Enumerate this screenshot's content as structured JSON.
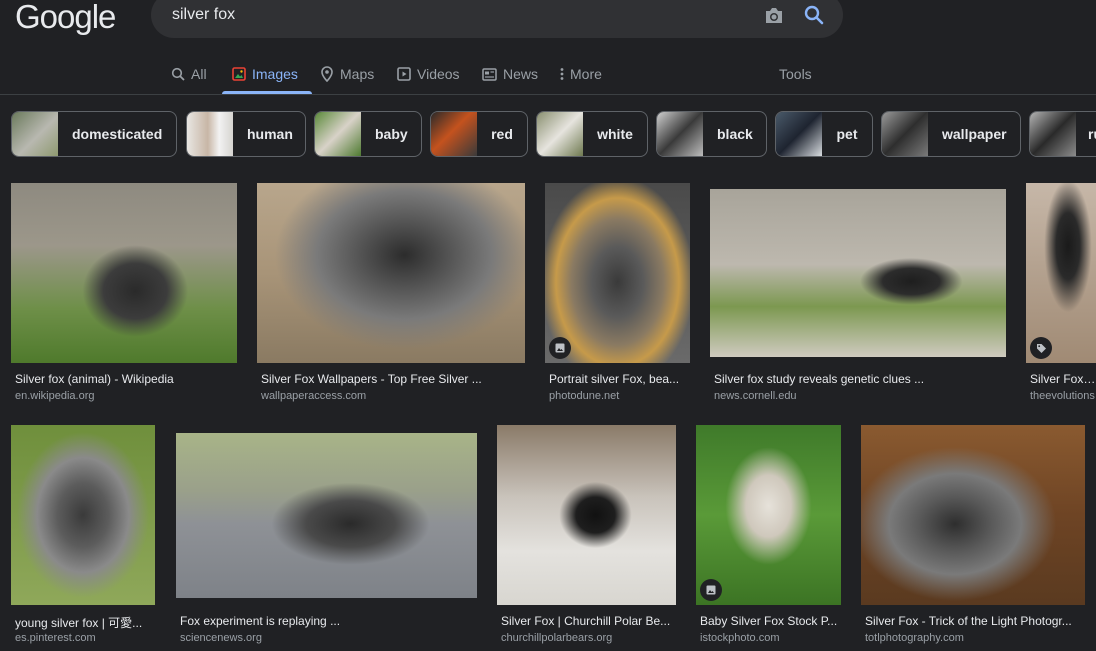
{
  "logo": "Google",
  "search": {
    "query": "silver fox"
  },
  "tabs": [
    {
      "label": "All",
      "icon": "search-icon"
    },
    {
      "label": "Images",
      "icon": "image-icon",
      "active": true
    },
    {
      "label": "Maps",
      "icon": "map-pin-icon"
    },
    {
      "label": "Videos",
      "icon": "play-icon"
    },
    {
      "label": "News",
      "icon": "news-icon"
    },
    {
      "label": "More",
      "icon": "more-vertical-icon"
    }
  ],
  "tools_label": "Tools",
  "chips": [
    {
      "label": "domesticated"
    },
    {
      "label": "human"
    },
    {
      "label": "baby"
    },
    {
      "label": "red"
    },
    {
      "label": "white"
    },
    {
      "label": "black"
    },
    {
      "label": "pet"
    },
    {
      "label": "wallpaper"
    },
    {
      "label": "ru"
    }
  ],
  "results": [
    {
      "title": "Silver fox (animal) - Wikipedia",
      "site": "en.wikipedia.org"
    },
    {
      "title": "Silver Fox Wallpapers - Top Free Silver ...",
      "site": "wallpaperaccess.com"
    },
    {
      "title": "Portrait silver Fox, bea...",
      "site": "photodune.net"
    },
    {
      "title": "Silver fox study reveals genetic clues ...",
      "site": "news.cornell.edu"
    },
    {
      "title": "Silver Fox - T",
      "site": "theevolutions"
    },
    {
      "title": "young silver fox | 可愛...",
      "site": "es.pinterest.com"
    },
    {
      "title": "Fox experiment is replaying ...",
      "site": "sciencenews.org"
    },
    {
      "title": "Silver Fox | Churchill Polar Be...",
      "site": "churchillpolarbears.org"
    },
    {
      "title": "Baby Silver Fox Stock P...",
      "site": "istockphoto.com"
    },
    {
      "title": "Silver Fox - Trick of the Light Photogr...",
      "site": "totlphotography.com"
    }
  ],
  "colors": {
    "background": "#202124",
    "accent": "#8ab4f8",
    "text": "#e8eaed",
    "muted": "#9aa0a6"
  }
}
